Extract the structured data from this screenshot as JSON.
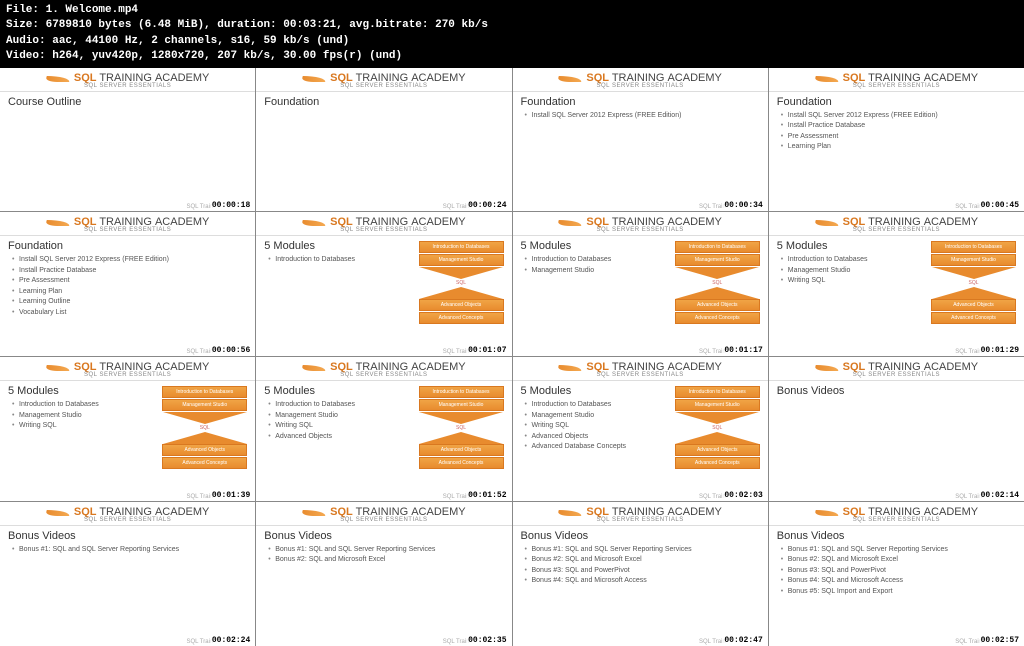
{
  "header": {
    "l1_a": "File: ",
    "l1_b": "1. Welcome.mp4",
    "l2_a": "Size: ",
    "l2_b": "6789810 ",
    "l2_c": "bytes ",
    "l2_d": "(6.48 MiB), ",
    "l2_e": "duration: ",
    "l2_f": "00:03:21, ",
    "l2_g": "avg.bitrate: ",
    "l2_h": "270 kb/s",
    "l3_a": "Audio: ",
    "l3_b": "aac, 44100 Hz, 2 channels, s16, 59 kb/s (und)",
    "l4_a": "Video: ",
    "l4_b": "h264, yuv420p, 1280x720, 207 kb/s, 30.00 fps(r) (und)"
  },
  "logo": {
    "sql": "SQL",
    "tr": " TRAINING ",
    "ac": "ACADEMY",
    "sub": "SQL SERVER ESSENTIALS",
    "foot": "SQL Train"
  },
  "diagram": {
    "b1": "Introduction to Databases",
    "b2": "Management Studio",
    "mid": "SQL",
    "b3": "Advanced Objects",
    "b4": "Advanced Concepts"
  },
  "cells": [
    {
      "title": "Course Outline",
      "bullets": [],
      "ts": "00:00:18",
      "diagram": false
    },
    {
      "title": "Foundation",
      "bullets": [],
      "ts": "00:00:24",
      "diagram": false
    },
    {
      "title": "Foundation",
      "bullets": [
        "Install SQL Server 2012 Express (FREE Edition)"
      ],
      "ts": "00:00:34",
      "diagram": false
    },
    {
      "title": "Foundation",
      "bullets": [
        "Install SQL Server 2012 Express (FREE Edition)",
        "Install Practice Database",
        "Pre Assessment",
        "Learning Plan"
      ],
      "ts": "00:00:45",
      "diagram": false
    },
    {
      "title": "Foundation",
      "bullets": [
        "Install SQL Server 2012 Express (FREE Edition)",
        "Install Practice Database",
        "Pre Assessment",
        "Learning Plan",
        "Learning Outline",
        "Vocabulary List"
      ],
      "ts": "00:00:56",
      "diagram": false
    },
    {
      "title": "5 Modules",
      "bullets": [
        "Introduction to Databases"
      ],
      "ts": "00:01:07",
      "diagram": true
    },
    {
      "title": "5 Modules",
      "bullets": [
        "Introduction to Databases",
        "Management Studio"
      ],
      "ts": "00:01:17",
      "diagram": true
    },
    {
      "title": "5 Modules",
      "bullets": [
        "Introduction to Databases",
        "Management Studio",
        "Writing SQL"
      ],
      "ts": "00:01:29",
      "diagram": true
    },
    {
      "title": "5 Modules",
      "bullets": [
        "Introduction to Databases",
        "Management Studio",
        "Writing SQL"
      ],
      "ts": "00:01:39",
      "diagram": true
    },
    {
      "title": "5 Modules",
      "bullets": [
        "Introduction to Databases",
        "Management Studio",
        "Writing SQL",
        "Advanced Objects"
      ],
      "ts": "00:01:52",
      "diagram": true
    },
    {
      "title": "5 Modules",
      "bullets": [
        "Introduction to Databases",
        "Management Studio",
        "Writing SQL",
        "Advanced Objects",
        "Advanced Database Concepts"
      ],
      "ts": "00:02:03",
      "diagram": true
    },
    {
      "title": "Bonus Videos",
      "bullets": [],
      "ts": "00:02:14",
      "diagram": false
    },
    {
      "title": "Bonus Videos",
      "bullets": [
        "Bonus #1: SQL and SQL Server Reporting Services"
      ],
      "ts": "00:02:24",
      "diagram": false
    },
    {
      "title": "Bonus Videos",
      "bullets": [
        "Bonus #1: SQL and SQL Server Reporting Services",
        "Bonus #2: SQL and Microsoft Excel"
      ],
      "ts": "00:02:35",
      "diagram": false
    },
    {
      "title": "Bonus Videos",
      "bullets": [
        "Bonus #1: SQL and SQL Server Reporting Services",
        "Bonus #2: SQL and Microsoft Excel",
        "Bonus #3: SQL and PowerPivot",
        "Bonus #4: SQL and Microsoft Access"
      ],
      "ts": "00:02:47",
      "diagram": false
    },
    {
      "title": "Bonus Videos",
      "bullets": [
        "Bonus #1: SQL and SQL Server Reporting Services",
        "Bonus #2: SQL and Microsoft Excel",
        "Bonus #3: SQL and PowerPivot",
        "Bonus #4: SQL and Microsoft Access",
        "Bonus #5: SQL Import and Export"
      ],
      "ts": "00:02:57",
      "diagram": false
    }
  ]
}
